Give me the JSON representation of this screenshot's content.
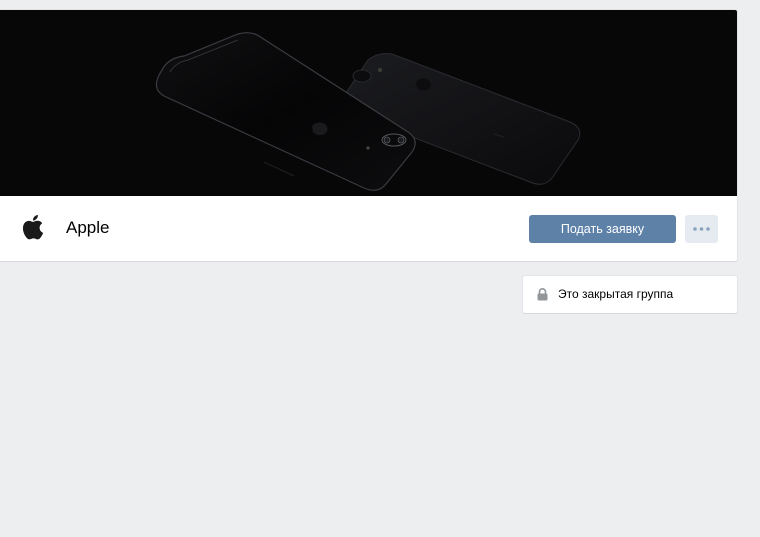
{
  "group": {
    "name": "Apple",
    "logo_icon": "apple-logo-icon"
  },
  "actions": {
    "apply_label": "Подать заявку",
    "more_icon": "more-dots-icon"
  },
  "privacy": {
    "icon": "lock-icon",
    "label": "Это закрытая группа"
  },
  "colors": {
    "page_background": "#edeef0",
    "card_background": "#ffffff",
    "cover_background": "#070708",
    "primary_button": "#5e81a8",
    "secondary_button": "#e5ebf1",
    "muted_icon": "#939699"
  }
}
